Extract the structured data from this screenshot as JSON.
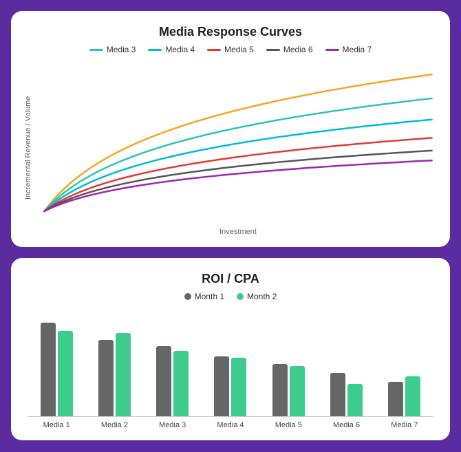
{
  "responseChart": {
    "title": "Media Response Curves",
    "yAxisLabel": "Incremental Revenue / Volume",
    "xAxisLabel": "Investment",
    "legend": [
      {
        "id": "media3",
        "label": "Media 3",
        "color": "#2EC4B6"
      },
      {
        "id": "media4",
        "label": "Media 4",
        "color": "#00BCD4"
      },
      {
        "id": "media5",
        "label": "Media 5",
        "color": "#E53935"
      },
      {
        "id": "media6",
        "label": "Media 6",
        "color": "#555"
      },
      {
        "id": "media7",
        "label": "Media 7",
        "color": "#9C27B0"
      }
    ],
    "curves": [
      {
        "id": "media1",
        "color": "#F5A623",
        "endY": 30
      },
      {
        "id": "media2",
        "color": "#2EC4B6",
        "endY": 60
      },
      {
        "id": "media3",
        "color": "#00BCD4",
        "endY": 90
      },
      {
        "id": "media4",
        "color": "#E53935",
        "endY": 120
      },
      {
        "id": "media5",
        "color": "#555",
        "endY": 140
      },
      {
        "id": "media6",
        "color": "#9C27B0",
        "endY": 158
      }
    ]
  },
  "barChart": {
    "title": "ROI / CPA",
    "legend": [
      {
        "id": "month1",
        "label": "Month 1",
        "color": "#666"
      },
      {
        "id": "month2",
        "label": "Month 2",
        "color": "#3DCC8E"
      }
    ],
    "groups": [
      {
        "label": "Media 1",
        "month1": 140,
        "month2": 128
      },
      {
        "label": "Media 2",
        "month1": 115,
        "month2": 125
      },
      {
        "label": "Media 3",
        "month1": 105,
        "month2": 98
      },
      {
        "label": "Media 4",
        "month1": 90,
        "month2": 88
      },
      {
        "label": "Media 5",
        "month1": 78,
        "month2": 75
      },
      {
        "label": "Media 6",
        "month1": 65,
        "month2": 48
      },
      {
        "label": "Media 7",
        "month1": 52,
        "month2": 60
      }
    ],
    "maxValue": 160
  }
}
